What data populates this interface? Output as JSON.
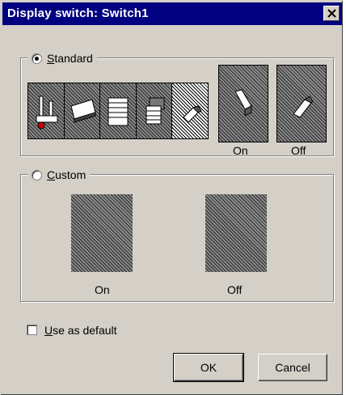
{
  "window": {
    "title": "Display switch: Switch1",
    "close_icon": "close-icon"
  },
  "standard": {
    "label_underline": "S",
    "label_rest": "tandard",
    "selected": true,
    "icons": [
      "switch-lever-icon",
      "switch-tray-icon",
      "switch-panel-icon",
      "switch-block-icon",
      "switch-toggle-icon"
    ],
    "on_label": "On",
    "off_label": "Off"
  },
  "custom": {
    "label_underline": "C",
    "label_rest": "ustom",
    "selected": false,
    "on_label": "On",
    "off_label": "Off"
  },
  "use_default": {
    "label_underline": "U",
    "label_rest": "se as default",
    "checked": false
  },
  "buttons": {
    "ok": "OK",
    "cancel": "Cancel"
  },
  "colors": {
    "titlebar": "#000080",
    "face": "#d4d0c8"
  }
}
